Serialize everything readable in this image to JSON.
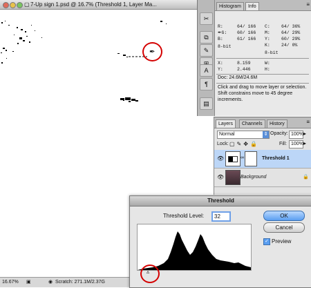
{
  "document": {
    "title": "7-Up sign 1.psd @ 16.7% (Threshold 1, Layer Ma...",
    "zoom": "16.67%",
    "scratch": "Scratch: 271.1M/2.37G"
  },
  "info_panel": {
    "tabs": [
      "Histogram",
      "Info"
    ],
    "active_tab": "Info",
    "rgb": {
      "r": "64/ 166",
      "g": "60/ 166",
      "b": "61/ 166"
    },
    "bit_left": "8-bit",
    "cmyk": {
      "c": "64/ 36%",
      "m": "64/ 29%",
      "y": "60/ 29%",
      "k": "24/ 0%"
    },
    "bit_right": "8-bit",
    "xy": {
      "x": "8.159",
      "y": "2.446"
    },
    "wh": {
      "w": "",
      "h": ""
    },
    "doc_size": "Doc: 24.6M/24.6M",
    "help": "Click and drag to move layer or selection. Shift constrains move to 45 degree increments."
  },
  "layers_panel": {
    "tabs": [
      "Layers",
      "Channels",
      "History"
    ],
    "active_tab": "Layers",
    "blend_mode": "Normal",
    "opacity_label": "Opacity:",
    "opacity": "100%",
    "lock_label": "Lock:",
    "fill_label": "Fill:",
    "fill": "100%",
    "layers": [
      {
        "name": "Threshold 1",
        "selected": true
      },
      {
        "name": "Background",
        "selected": false
      }
    ]
  },
  "threshold_dialog": {
    "title": "Threshold",
    "level_label": "Threshold Level:",
    "level_value": "32",
    "ok": "OK",
    "cancel": "Cancel",
    "preview_label": "Preview",
    "preview_checked": true
  },
  "colors": {
    "annotation": "#d40000",
    "selection": "#bcd6f7",
    "primary_button": "#5a9ef0"
  }
}
